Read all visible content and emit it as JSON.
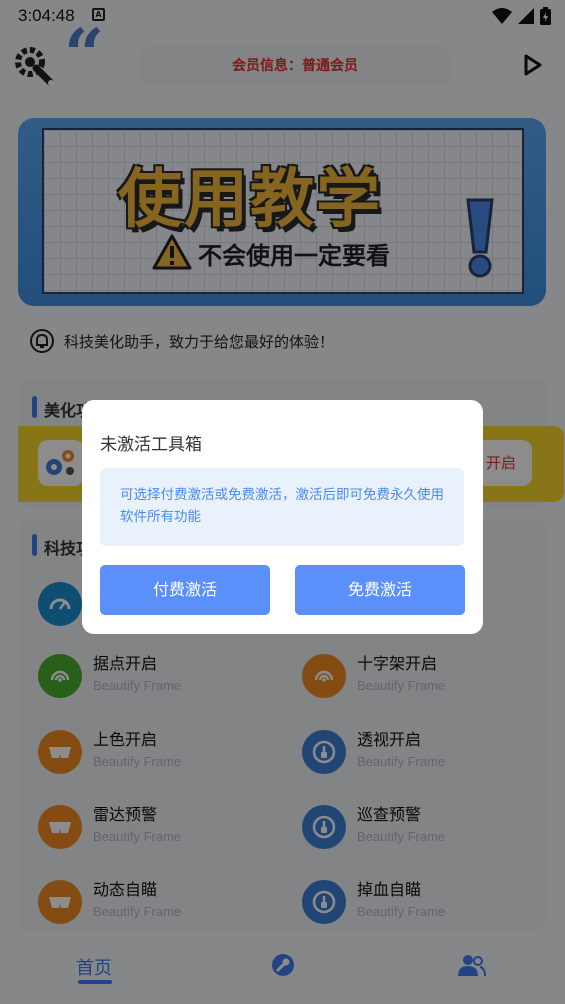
{
  "status_bar": {
    "time": "3:04:48",
    "notification_badge": "A"
  },
  "header": {
    "member_info": "会员信息：普通会员"
  },
  "banner": {
    "quote_mark": "“",
    "title": "使用教学",
    "subtitle": "不会使用一定要看"
  },
  "notice": {
    "text": "科技美化助手，致力于给您最好的体验！"
  },
  "section_beautify": {
    "title": "美化功能",
    "toggle_label": "开启"
  },
  "section_tech": {
    "title": "科技功能",
    "items": [
      {
        "name": "据点开启",
        "sub": "Beautify Frame"
      },
      {
        "name": "十字架开启",
        "sub": "Beautify Frame"
      },
      {
        "name": "上色开启",
        "sub": "Beautify Frame"
      },
      {
        "name": "透视开启",
        "sub": "Beautify Frame"
      },
      {
        "name": "雷达预警",
        "sub": "Beautify Frame"
      },
      {
        "name": "巡查预警",
        "sub": "Beautify Frame"
      },
      {
        "name": "动态自瞄",
        "sub": "Beautify Frame"
      },
      {
        "name": "掉血自瞄",
        "sub": "Beautify Frame"
      }
    ]
  },
  "bottom_nav": {
    "home_label": "首页"
  },
  "dialog": {
    "title": "未激活工具箱",
    "message": "可选择付费激活或免费激活，激活后即可免费永久使用软件所有功能",
    "paid_button": "付费激活",
    "free_button": "免费激活"
  },
  "colors": {
    "accent": "#5b8ff9",
    "member_red": "#e03030",
    "yellow_card": "#f6d62a",
    "banner_blue": "#4a9be8"
  }
}
